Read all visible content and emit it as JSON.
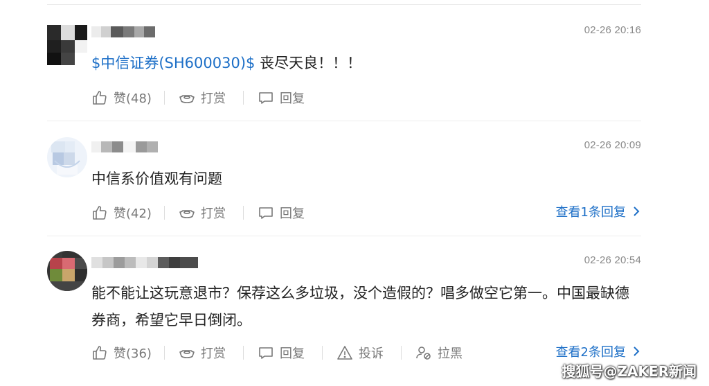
{
  "comments": [
    {
      "timestamp": "02-26 20:16",
      "content_link": "$中信证券(SH600030)$",
      "content_text": " 丧尽天良！！！",
      "actions": {
        "like": "赞(48)",
        "tip": "打赏",
        "reply": "回复"
      }
    },
    {
      "timestamp": "02-26 20:09",
      "content_text": "中信系价值观有问题",
      "actions": {
        "like": "赞(42)",
        "tip": "打赏",
        "reply": "回复"
      },
      "view_replies": "查看1条回复"
    },
    {
      "timestamp": "02-26 20:54",
      "content_text": "能不能让这玩意退市？保荐这么多垃圾，没个造假的？唱多做空它第一。中国最缺德券商，希望它早日倒闭。",
      "actions": {
        "like": "赞(36)",
        "tip": "打赏",
        "reply": "回复",
        "report": "投诉",
        "block": "拉黑"
      },
      "view_replies": "查看2条回复"
    }
  ],
  "watermark": "搜狐号@ZAKER新闻",
  "colors": {
    "link": "#1d6fc7",
    "text": "#222222",
    "muted": "#777777",
    "timestamp": "#888888",
    "divider": "#ececec"
  },
  "icons": {
    "like": "thumbs-up-icon",
    "tip": "gold-ingot-icon",
    "reply": "speech-bubble-icon",
    "report": "warning-triangle-icon",
    "block": "user-block-icon",
    "chevron": "chevron-right-icon"
  }
}
